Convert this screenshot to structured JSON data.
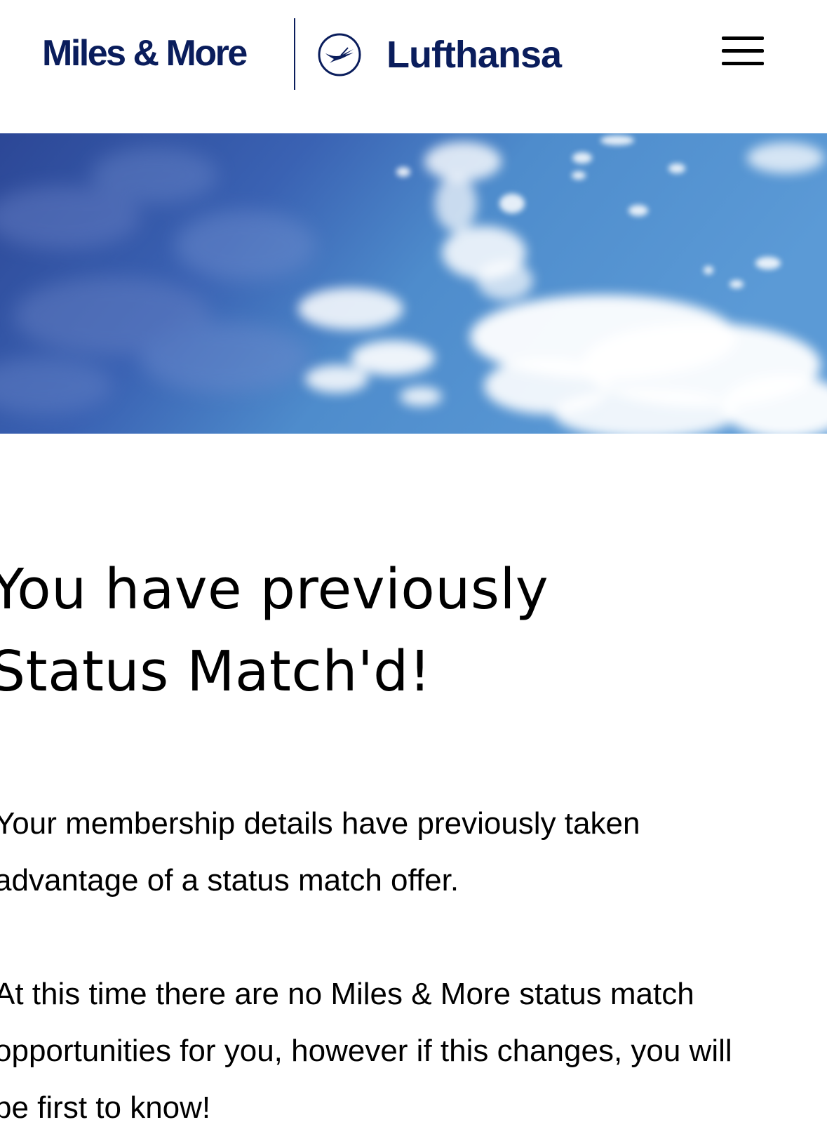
{
  "header": {
    "brand_primary": "Miles & More",
    "brand_secondary": "Lufthansa",
    "logo_icon": "crane-icon",
    "menu_icon": "hamburger-menu-icon",
    "brand_color": "#0a1d5c"
  },
  "hero": {
    "image": "sky-with-clouds",
    "colors": [
      "#2b4a9c",
      "#4e8fcd",
      "#ffffff"
    ]
  },
  "main": {
    "title_line1": "You have previously",
    "title_line2": "Status Match'd!",
    "paragraph1_line1": "Your membership details have previously taken",
    "paragraph1_line2": "advantage of a status match offer.",
    "paragraph2_line1": "At this time there are no Miles & More status match",
    "paragraph2_line2": "opportunities for you, however if this changes, you will",
    "paragraph2_line3": "be first to know!"
  }
}
